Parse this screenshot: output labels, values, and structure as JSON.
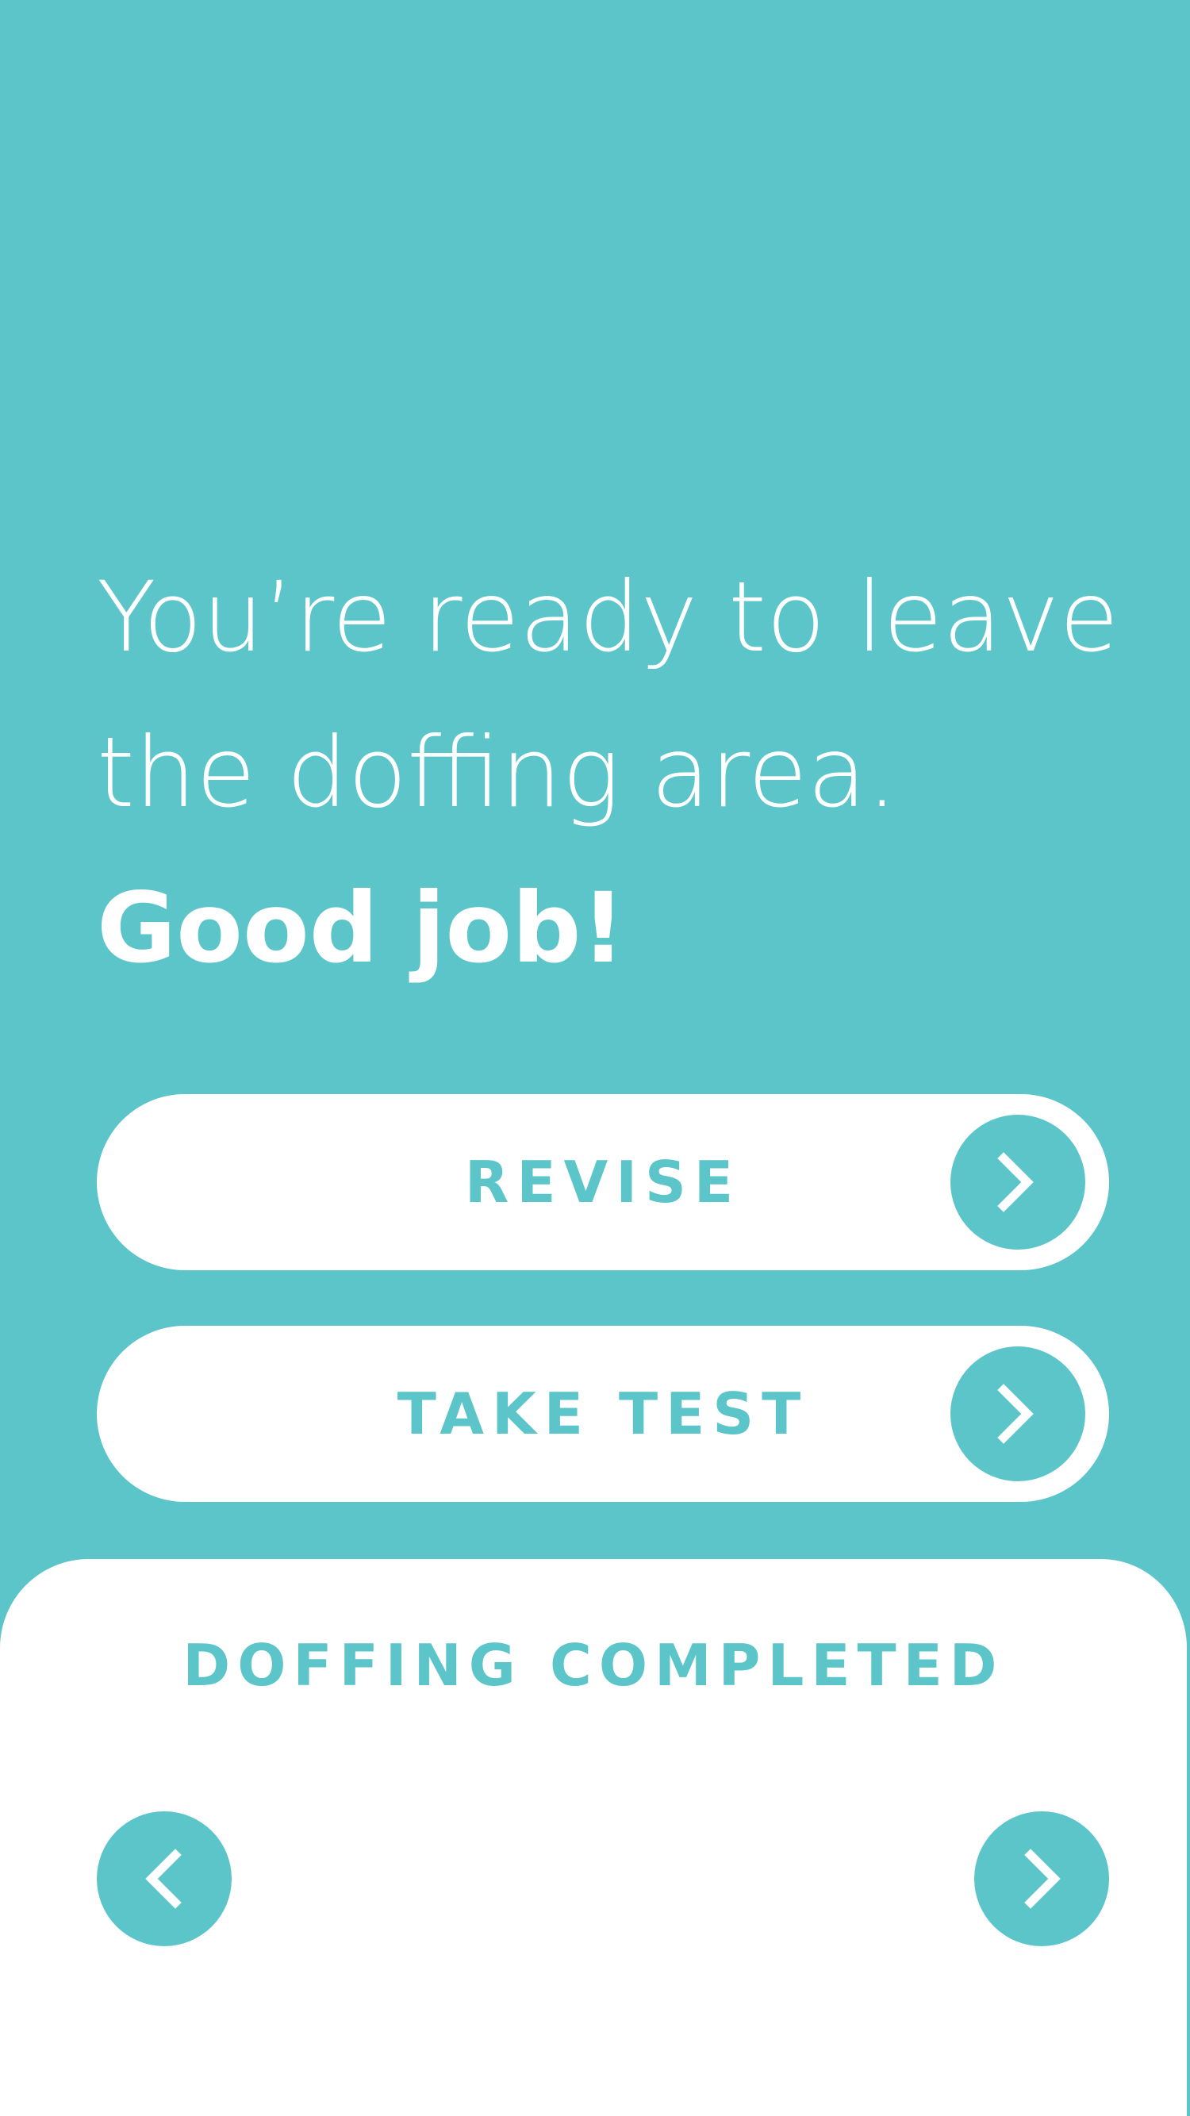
{
  "theme": {
    "accent": "#5cc5ca",
    "surface": "#ffffff"
  },
  "message": {
    "line1": "You’re ready to leave",
    "line2": "the doffing area.",
    "emphasis": "Good job!"
  },
  "actions": [
    {
      "label": "REVISE",
      "icon": "chevron-right-icon"
    },
    {
      "label": "TAKE TEST",
      "icon": "chevron-right-icon"
    }
  ],
  "sheet": {
    "title": "DOFFING COMPLETED",
    "prev_icon": "chevron-left-icon",
    "next_icon": "chevron-right-icon"
  }
}
